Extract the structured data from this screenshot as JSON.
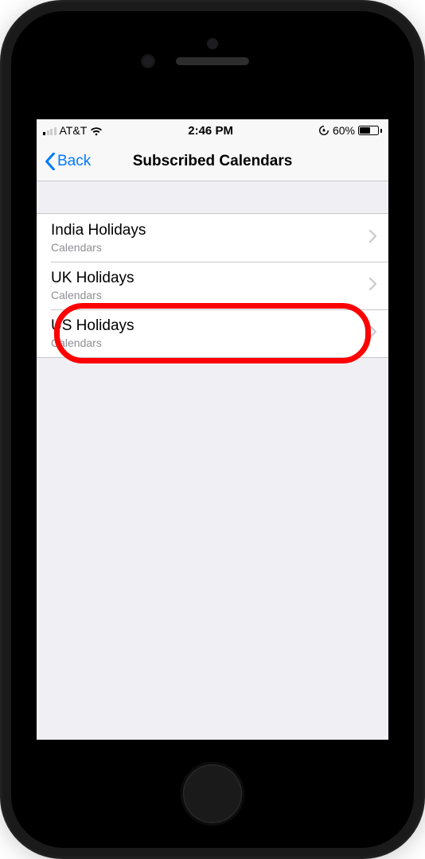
{
  "status": {
    "carrier": "AT&T",
    "time": "2:46 PM",
    "battery_pct": "60%",
    "battery_level": 60
  },
  "nav": {
    "back_label": "Back",
    "title": "Subscribed Calendars"
  },
  "rows": [
    {
      "title": "India Holidays",
      "subtitle": "Calendars"
    },
    {
      "title": "UK Holidays",
      "subtitle": "Calendars"
    },
    {
      "title": "US Holidays",
      "subtitle": "Calendars"
    }
  ],
  "highlighted_index": 2
}
